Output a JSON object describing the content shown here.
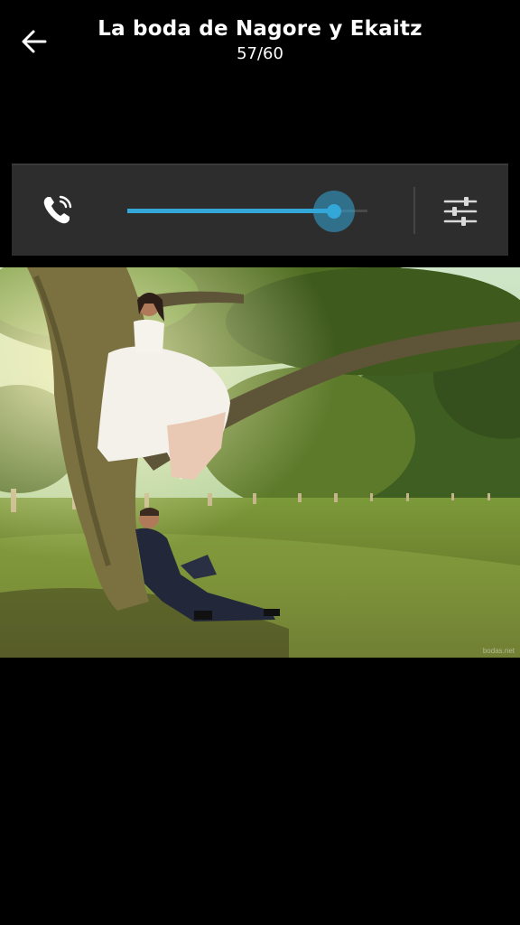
{
  "header": {
    "title": "La boda de Nagore y Ekaitz",
    "counter": "57/60",
    "back_icon": "arrow-left-icon"
  },
  "volume_panel": {
    "stream_icon": "phone-ringing-icon",
    "volume_level": 0.86,
    "accent_color": "#33a7d8",
    "settings_icon": "sliders-icon"
  },
  "photo": {
    "subject": "wedding-photo",
    "watermark": "bodas.net"
  }
}
